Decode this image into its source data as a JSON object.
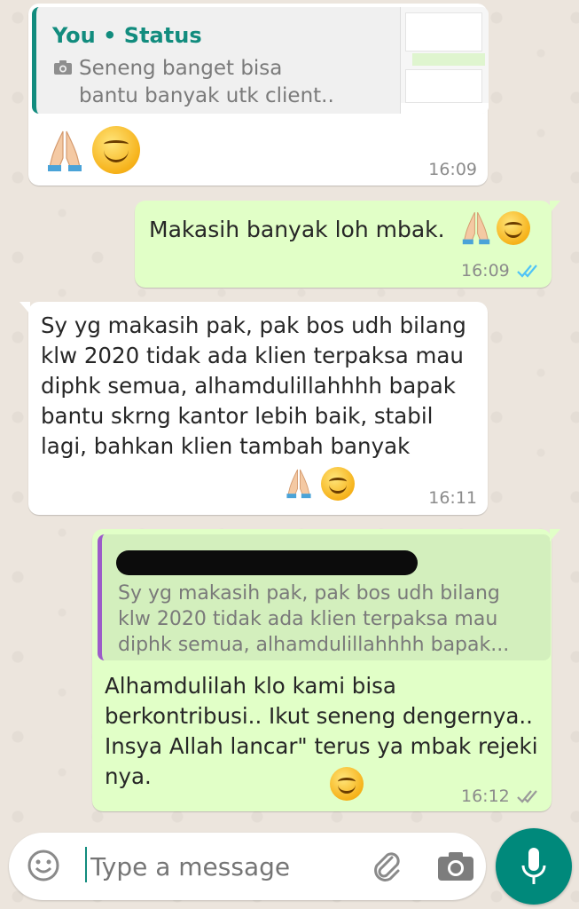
{
  "status_reply": {
    "quote_name": "You • Status",
    "quote_text": "Seneng banget bisa bantu banyak utk client..",
    "time": "16:09"
  },
  "messages": [
    {
      "text": "Makasih banyak loh mbak.",
      "time": "16:09",
      "status": "read"
    },
    {
      "text": "Sy yg makasih pak, pak bos udh bilang klw 2020 tidak ada klien terpaksa mau diphk semua, alhamdulillahhhh bapak bantu skrng kantor lebih baik, stabil lagi, bahkan klien tambah banyak",
      "time": "16:11"
    },
    {
      "quote_text": "Sy yg makasih pak, pak bos udh bilang klw 2020 tidak ada klien terpaksa mau diphk semua, alhamdulillahhhh bapak...",
      "text": "Alhamdulilah klo kami bisa berkontribusi.. Ikut seneng dengernya.. Insya Allah lancar\" terus ya mbak rejeki nya.",
      "time": "16:12",
      "status": "delivered"
    }
  ],
  "input": {
    "placeholder": "Type a message"
  },
  "icons": {
    "emoji": "emoji-icon",
    "attach": "paperclip-icon",
    "camera": "camera-icon",
    "mic": "microphone-icon",
    "status_camera": "camera-small-icon"
  },
  "colors": {
    "accent": "#128c7e",
    "outgoing": "#e1ffc7",
    "read_ticks": "#4fc3f7",
    "mic_button": "#00897b"
  }
}
